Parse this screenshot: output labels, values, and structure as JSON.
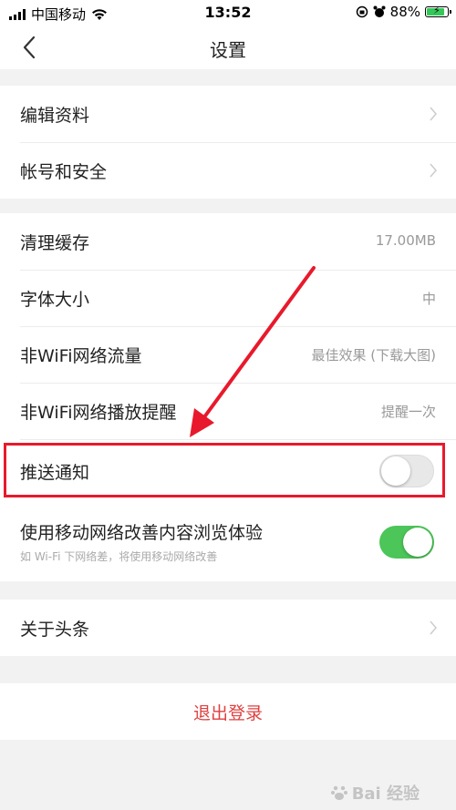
{
  "status_bar": {
    "carrier": "中国移动",
    "time": "13:52",
    "battery": "88%"
  },
  "nav": {
    "title": "设置"
  },
  "group1": {
    "items": [
      {
        "label": "编辑资料"
      },
      {
        "label": "帐号和安全"
      }
    ]
  },
  "group2": {
    "items": [
      {
        "label": "清理缓存",
        "value": "17.00MB"
      },
      {
        "label": "字体大小",
        "value": "中"
      },
      {
        "label": "非WiFi网络流量",
        "value": "最佳效果 (下载大图)"
      },
      {
        "label": "非WiFi网络播放提醒",
        "value": "提醒一次"
      },
      {
        "label": "推送通知",
        "toggle": false
      },
      {
        "label": "使用移动网络改善内容浏览体验",
        "sub": "如 Wi-Fi 下网络差，将使用移动网络改善",
        "toggle": true
      }
    ]
  },
  "group3": {
    "items": [
      {
        "label": "关于头条"
      }
    ]
  },
  "logout_label": "退出登录",
  "colors": {
    "accent_red": "#e04040",
    "toggle_on": "#4cc559",
    "annotation_red": "#e8192c"
  },
  "watermark": "Bai 经验"
}
